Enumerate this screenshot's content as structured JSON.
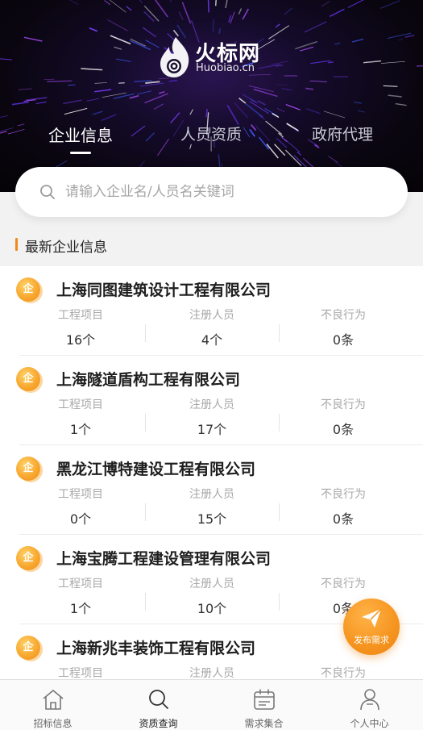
{
  "brand": {
    "name_cn": "火标网",
    "domain": "Huobiao.cn"
  },
  "tabs": [
    {
      "label": "企业信息",
      "active": true
    },
    {
      "label": "人员资质",
      "active": false
    },
    {
      "label": "政府代理",
      "active": false
    }
  ],
  "search": {
    "placeholder": "请输入企业名/人员名关键词",
    "value": ""
  },
  "section": {
    "title": "最新企业信息"
  },
  "stat_labels": {
    "projects": "工程项目",
    "staff": "注册人员",
    "violations": "不良行为"
  },
  "companies": [
    {
      "badge": "企",
      "name": "上海同图建筑设计工程有限公司",
      "projects": "16个",
      "staff": "4个",
      "violations": "0条"
    },
    {
      "badge": "企",
      "name": "上海隧道盾构工程有限公司",
      "projects": "1个",
      "staff": "17个",
      "violations": "0条"
    },
    {
      "badge": "企",
      "name": "黑龙江博特建设工程有限公司",
      "projects": "0个",
      "staff": "15个",
      "violations": "0条"
    },
    {
      "badge": "企",
      "name": "上海宝腾工程建设管理有限公司",
      "projects": "1个",
      "staff": "10个",
      "violations": "0条"
    },
    {
      "badge": "企",
      "name": "上海新兆丰装饰工程有限公司",
      "projects": "",
      "staff": "",
      "violations": ""
    }
  ],
  "fab": {
    "label": "发布需求",
    "icon": "paper-plane-icon"
  },
  "bottom_nav": [
    {
      "label": "招标信息",
      "icon": "house-icon",
      "active": false
    },
    {
      "label": "资质查询",
      "icon": "search-icon",
      "active": true
    },
    {
      "label": "需求集合",
      "icon": "calendar-icon",
      "active": false
    },
    {
      "label": "个人中心",
      "icon": "person-icon",
      "active": false
    }
  ],
  "colors": {
    "accent": "#f08a1c",
    "header_bg": "#0a0610",
    "star_purple": "#7a3cff"
  }
}
